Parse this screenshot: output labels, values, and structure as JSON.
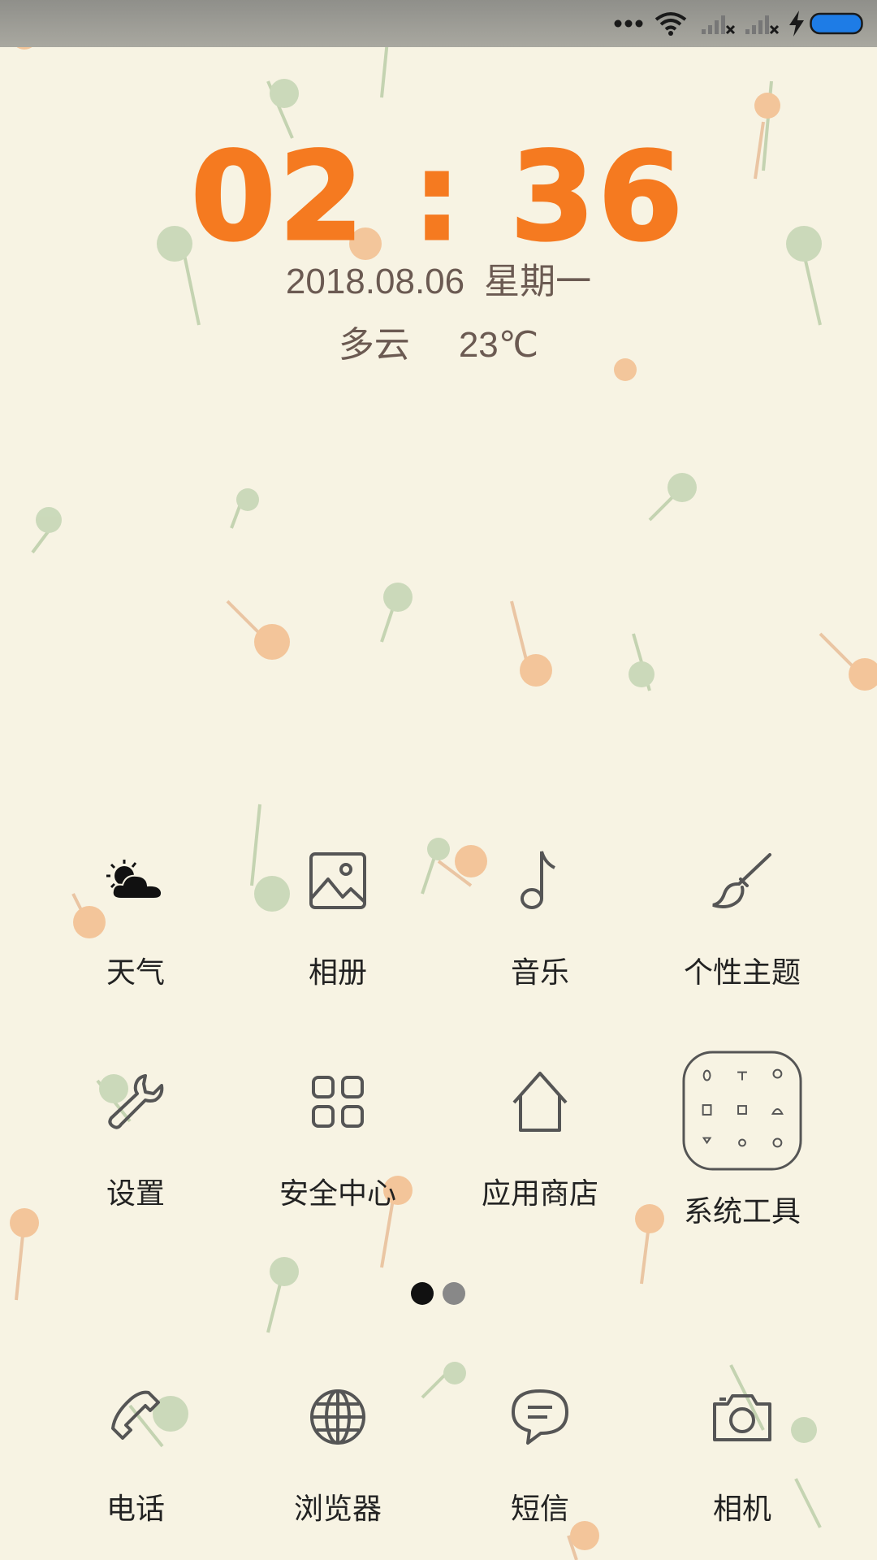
{
  "status_bar": {
    "icons": [
      "more-dots-icon",
      "wifi-icon",
      "signal-no-service-icon",
      "signal-no-service-icon",
      "charging-bolt-icon",
      "battery-icon"
    ]
  },
  "clock": {
    "time": "02 : 36"
  },
  "date": {
    "date": "2018.08.06",
    "weekday": "星期一"
  },
  "weather": {
    "condition": "多云",
    "temperature": "23℃"
  },
  "apps": {
    "row1": [
      {
        "label": "天气",
        "icon": "weather-cloud-sun-icon"
      },
      {
        "label": "相册",
        "icon": "gallery-image-icon"
      },
      {
        "label": "音乐",
        "icon": "music-note-icon"
      },
      {
        "label": "个性主题",
        "icon": "theme-brush-icon"
      }
    ],
    "row2": [
      {
        "label": "设置",
        "icon": "wrench-icon"
      },
      {
        "label": "安全中心",
        "icon": "grid-squares-icon"
      },
      {
        "label": "应用商店",
        "icon": "house-icon"
      },
      {
        "label": "系统工具",
        "icon": "folder-icon"
      }
    ]
  },
  "pager": {
    "pages": 2,
    "current": 1
  },
  "dock": [
    {
      "label": "电话",
      "icon": "phone-icon"
    },
    {
      "label": "浏览器",
      "icon": "globe-icon"
    },
    {
      "label": "短信",
      "icon": "chat-bubble-icon"
    },
    {
      "label": "相机",
      "icon": "camera-icon"
    }
  ],
  "colors": {
    "clock": "#f57a20",
    "text": "#6b5a52",
    "battery": "#1e7ce6",
    "background": "#f7f3e3"
  }
}
